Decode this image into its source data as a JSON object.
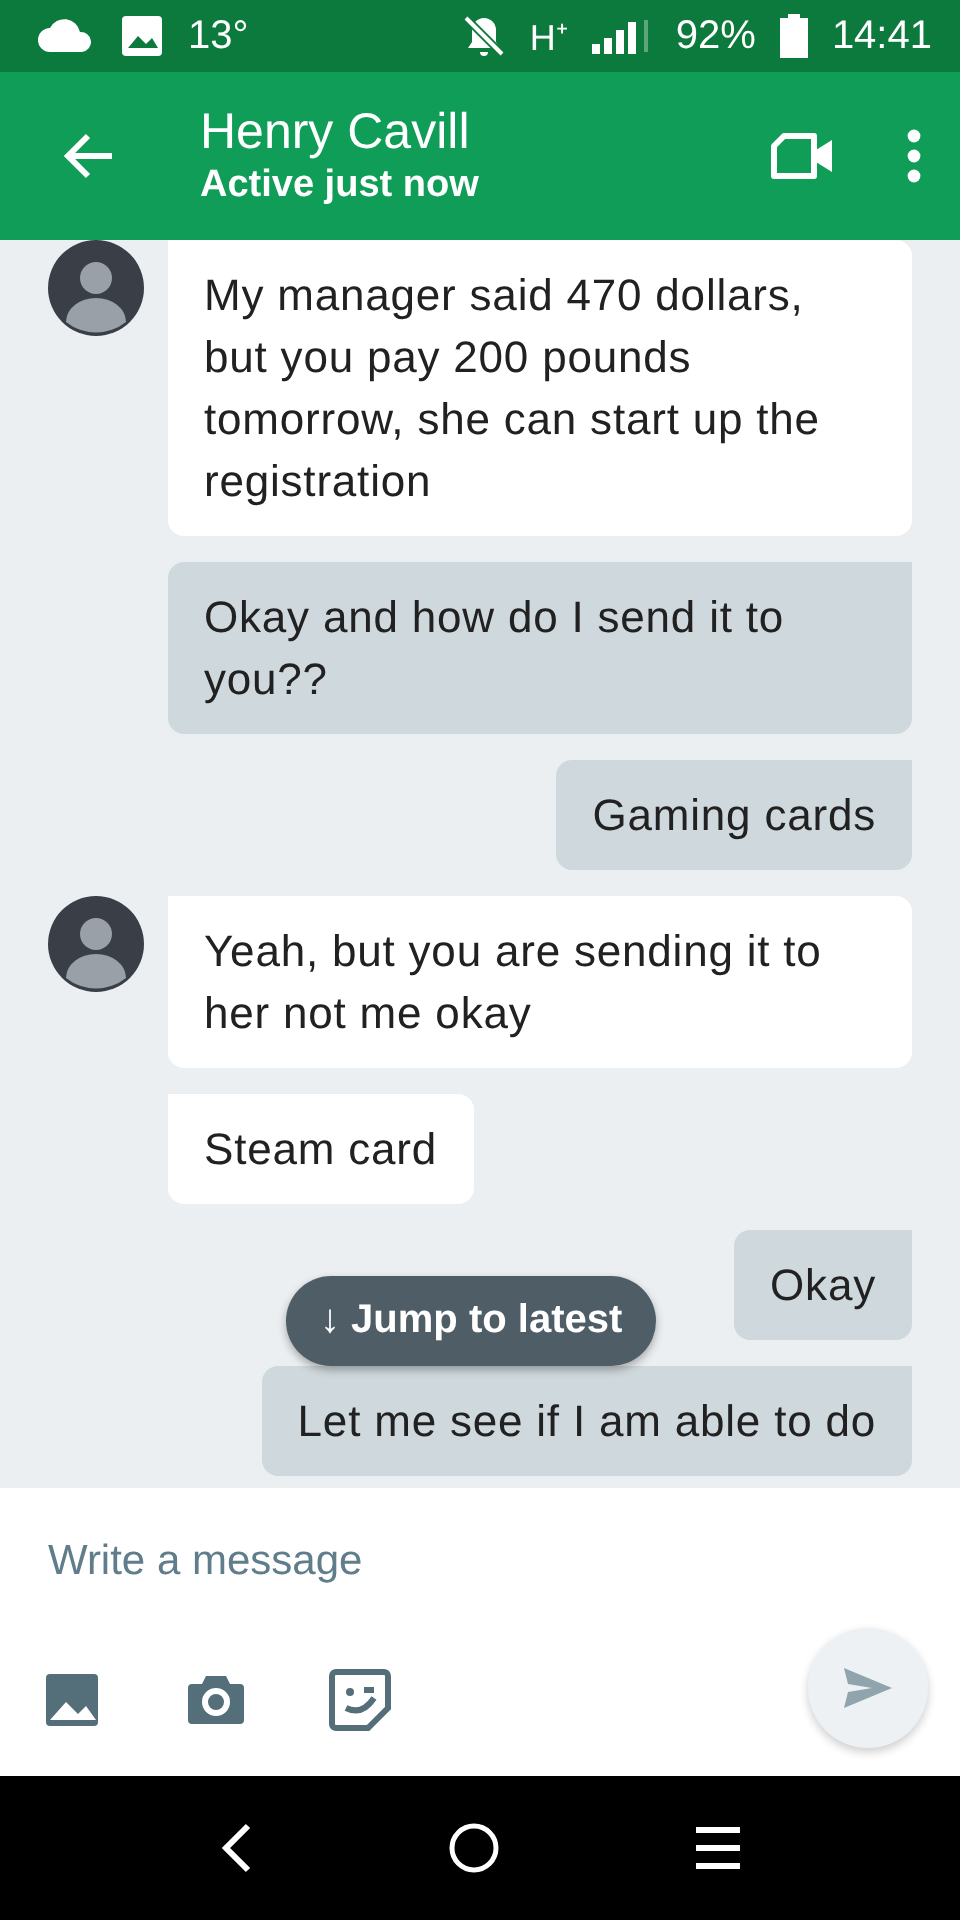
{
  "status_bar": {
    "temperature": "13°",
    "network": "H⁺",
    "battery": "92%",
    "time": "14:41"
  },
  "header": {
    "title": "Henry Cavill",
    "subtitle": "Active just now"
  },
  "messages": [
    {
      "kind": "received",
      "avatar": true,
      "text": "My manager said 470 dollars, but you pay 200 pounds tomorrow, she can start up the registration"
    },
    {
      "kind": "sent",
      "text": "Okay and how do I send it to you??"
    },
    {
      "kind": "sent",
      "text": "Gaming cards"
    },
    {
      "kind": "received",
      "avatar": true,
      "text": "Yeah, but you are sending it to her not me okay"
    },
    {
      "kind": "received",
      "avatar": false,
      "text": "Steam card"
    },
    {
      "kind": "sent",
      "text": "Okay"
    },
    {
      "kind": "sent",
      "text": "Let me see if I am able to do"
    }
  ],
  "jump_button": {
    "label": "↓ Jump to latest"
  },
  "composer": {
    "placeholder": "Write a message"
  }
}
